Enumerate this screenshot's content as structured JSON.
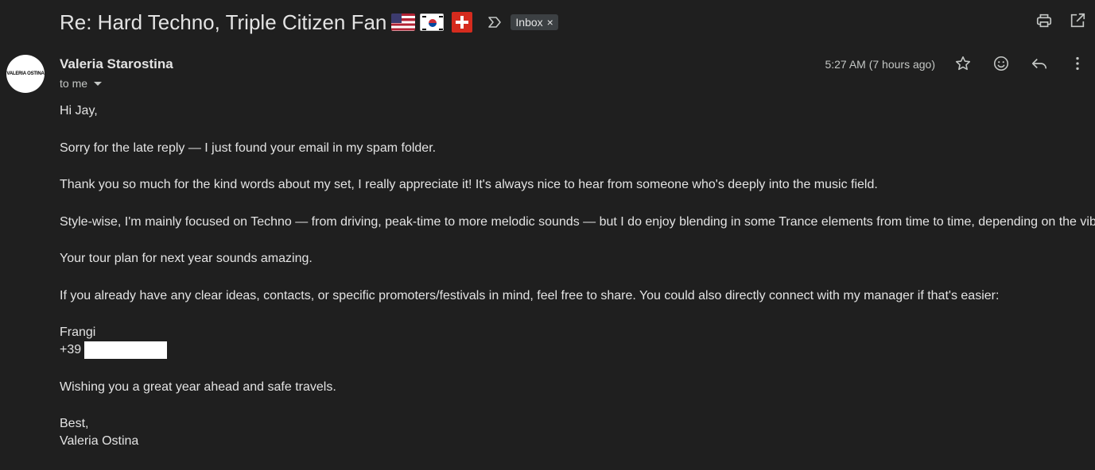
{
  "subject": {
    "title": "Re: Hard Techno, Triple Citizen Fan",
    "label": "Inbox",
    "label_remove": "×",
    "flags": [
      "us-flag",
      "south-korea-flag",
      "switzerland-flag"
    ]
  },
  "sender": {
    "name": "Valeria Starostina",
    "avatar_text": "VALERIA OSTINA",
    "recipient": "to me"
  },
  "timestamp": "5:27 AM (7 hours ago)",
  "top_actions": [
    "print-icon",
    "open-in-new-window-icon"
  ],
  "message_actions": [
    "star-icon",
    "emoji-icon",
    "reply-icon",
    "more-vertical-icon"
  ],
  "body": {
    "greeting": "Hi Jay,",
    "p1": "Sorry for the late reply — I just found your email in my spam folder.",
    "p2": "Thank you so much for the kind words about my set, I really appreciate it! It's always nice to hear from someone who's deeply into the music field.",
    "p3": "Style-wise, I'm mainly focused on Techno — from driving, peak-time to more melodic sounds — but I do enjoy blending in some Trance elements from time to time, depending on the vibe.",
    "p4": "Your tour plan for next year sounds amazing.",
    "p5": "If you already have any clear ideas, contacts, or specific promoters/festivals in mind, feel free to share. You could also directly connect with my manager if that's easier:",
    "manager_name": "Frangi",
    "manager_phone_prefix": "+39",
    "p6": "Wishing you a great year ahead and safe travels.",
    "closing": "Best,",
    "signature": "Valeria Ostina"
  },
  "colors": {
    "background": "#1f1f1f",
    "text": "#e3e3e3",
    "secondary_text": "#c4c7c5",
    "chip_bg": "#3c4043"
  }
}
